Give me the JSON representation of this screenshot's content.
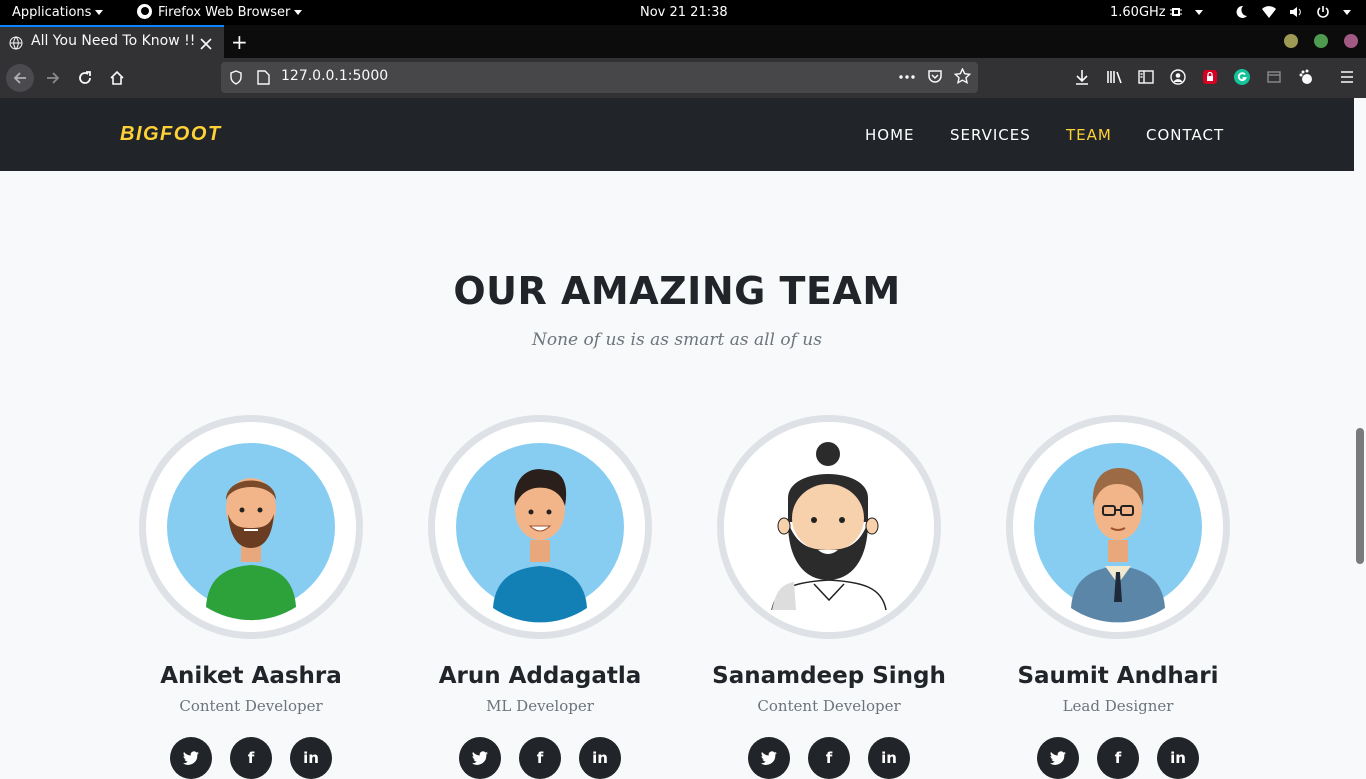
{
  "os_panel": {
    "applications_label": "Applications",
    "browser_label": "Firefox Web Browser",
    "datetime": "Nov 21  21:38",
    "cpu_freq": "1.60GHz"
  },
  "browser": {
    "tab_title": "All You Need To Know !!",
    "new_tab_symbol": "+",
    "url": "127.0.0.1:5000",
    "window_control_colors": [
      "#9e9a55",
      "#4e9a4e",
      "#a05a83"
    ]
  },
  "site": {
    "brand": "BIGFOOT",
    "nav": [
      {
        "label": "HOME",
        "active": false
      },
      {
        "label": "SERVICES",
        "active": false
      },
      {
        "label": "TEAM",
        "active": true
      },
      {
        "label": "CONTACT",
        "active": false
      }
    ],
    "accent_color": "#fed136",
    "section_heading": "OUR AMAZING TEAM",
    "section_subheading": "None of us is as smart as all of us",
    "team": [
      {
        "name": "Aniket Aashra",
        "role": "Content Developer",
        "avatar": "man-beard-green-shirt-avatar"
      },
      {
        "name": "Arun Addagatla",
        "role": "ML Developer",
        "avatar": "man-blue-shirt-avatar"
      },
      {
        "name": "Sanamdeep Singh",
        "role": "Content Developer",
        "avatar": "man-topknot-beard-avatar"
      },
      {
        "name": "Saumit Andhari",
        "role": "Lead Designer",
        "avatar": "man-suit-glasses-avatar"
      }
    ],
    "social_icons": [
      "twitter-icon",
      "facebook-icon",
      "linkedin-icon"
    ],
    "social_labels": {
      "facebook": "f",
      "linkedin": "in"
    }
  }
}
